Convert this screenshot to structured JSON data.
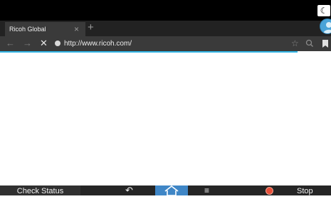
{
  "status": {
    "mode_icon": "moon-icon",
    "avatar_icon": "user-avatar-icon"
  },
  "tab": {
    "title": "Ricoh Global",
    "close_icon": "×",
    "new_tab_icon": "+"
  },
  "address_bar": {
    "back_icon": "←",
    "forward_icon": "→",
    "stop_icon": "✕",
    "url": "http://www.ricoh.com/",
    "star_icon": "☆"
  },
  "colors": {
    "accent": "#33b5e5",
    "home": "#3f86c6",
    "stop": "#e8503a"
  },
  "bottom_bar": {
    "check_status": "Check Status",
    "back_icon": "↶",
    "menu_icon": "≡",
    "stop_label": "Stop"
  }
}
